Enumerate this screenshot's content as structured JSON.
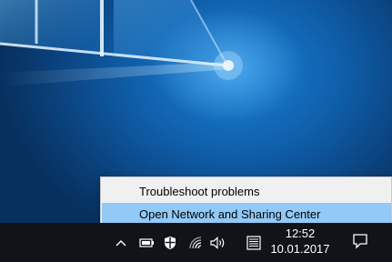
{
  "context_menu": {
    "items": [
      {
        "label": "Troubleshoot problems",
        "highlighted": false
      },
      {
        "label": "Open Network and Sharing Center",
        "highlighted": true
      }
    ]
  },
  "taskbar": {
    "tray_icons": [
      "chevron-up-icon",
      "battery-icon",
      "defender-shield-icon",
      "wifi-icon",
      "speaker-icon",
      "keyboard-icon"
    ],
    "clock": {
      "time": "12:52",
      "date": "10.01.2017"
    },
    "notification_icon": "action-center-icon"
  },
  "colors": {
    "menu_highlight": "#91c9f7",
    "taskbar_bg": "#101419",
    "desktop_blue": "#0f5ea9"
  }
}
